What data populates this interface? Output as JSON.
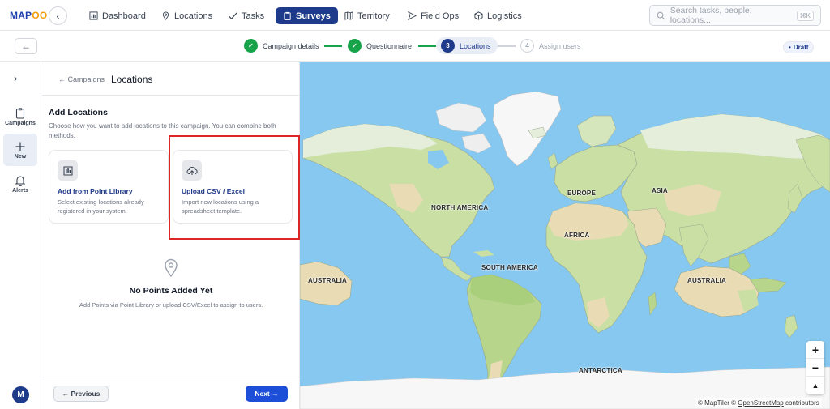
{
  "app": {
    "logo_text": "MAP",
    "logo_accent": "OO"
  },
  "nav": [
    {
      "label": "Dashboard",
      "icon": "bar-chart-icon"
    },
    {
      "label": "Locations",
      "icon": "pin-icon"
    },
    {
      "label": "Tasks",
      "icon": "check-icon"
    },
    {
      "label": "Surveys",
      "icon": "clipboard-icon",
      "active": true
    },
    {
      "label": "Territory",
      "icon": "map-icon"
    },
    {
      "label": "Field Ops",
      "icon": "send-icon"
    },
    {
      "label": "Logistics",
      "icon": "box-icon"
    }
  ],
  "search": {
    "placeholder": "Search tasks, people, locations...",
    "shortcut": "⌘K"
  },
  "stepper": {
    "steps": [
      {
        "label": "Campaign details",
        "state": "done",
        "marker": "✓"
      },
      {
        "label": "Questionnaire",
        "state": "done",
        "marker": "✓"
      },
      {
        "label": "Locations",
        "state": "current",
        "marker": "3"
      },
      {
        "label": "Assign users",
        "state": "todo",
        "marker": "4"
      }
    ],
    "status": "Draft"
  },
  "rail": {
    "items": [
      {
        "label": "Campaigns"
      },
      {
        "label": "New",
        "selected": true
      },
      {
        "label": "Alerts"
      }
    ],
    "avatar_initial": "M"
  },
  "panel": {
    "breadcrumb": "← Campaigns",
    "title": "Locations",
    "section_title": "Add Locations",
    "section_subtitle": "Choose how you want to add locations to this campaign. You can combine both methods.",
    "cards": [
      {
        "title": "Add from Point Library",
        "description": "Select existing locations already registered in your system."
      },
      {
        "title": "Upload CSV / Excel",
        "description": "Import new locations using a spreadsheet template."
      }
    ],
    "empty_title": "No Points Added Yet",
    "empty_subtitle": "Add Points via Point Library or upload CSV/Excel to assign to users.",
    "prev_label": "← Previous",
    "next_label": "Next →"
  },
  "map": {
    "labels": [
      "NORTH AMERICA",
      "EUROPE",
      "ASIA",
      "AFRICA",
      "SOUTH AMERICA",
      "AUSTRALIA",
      "AUSTRALIA",
      "ANTARCTICA"
    ],
    "zoom_in": "+",
    "zoom_out": "−",
    "compass": "▲",
    "attribution_prefix": "© MapTiler © ",
    "attribution_link": "OpenStreetMap",
    "attribution_suffix": " contributors"
  },
  "colors": {
    "primary": "#1e3a8a",
    "success": "#16a34a",
    "highlight": "#dc2626",
    "water": "#86c8f0",
    "land": "#c9dfa4",
    "desert": "#e9dcb5",
    "ice": "#f7f7f7"
  }
}
